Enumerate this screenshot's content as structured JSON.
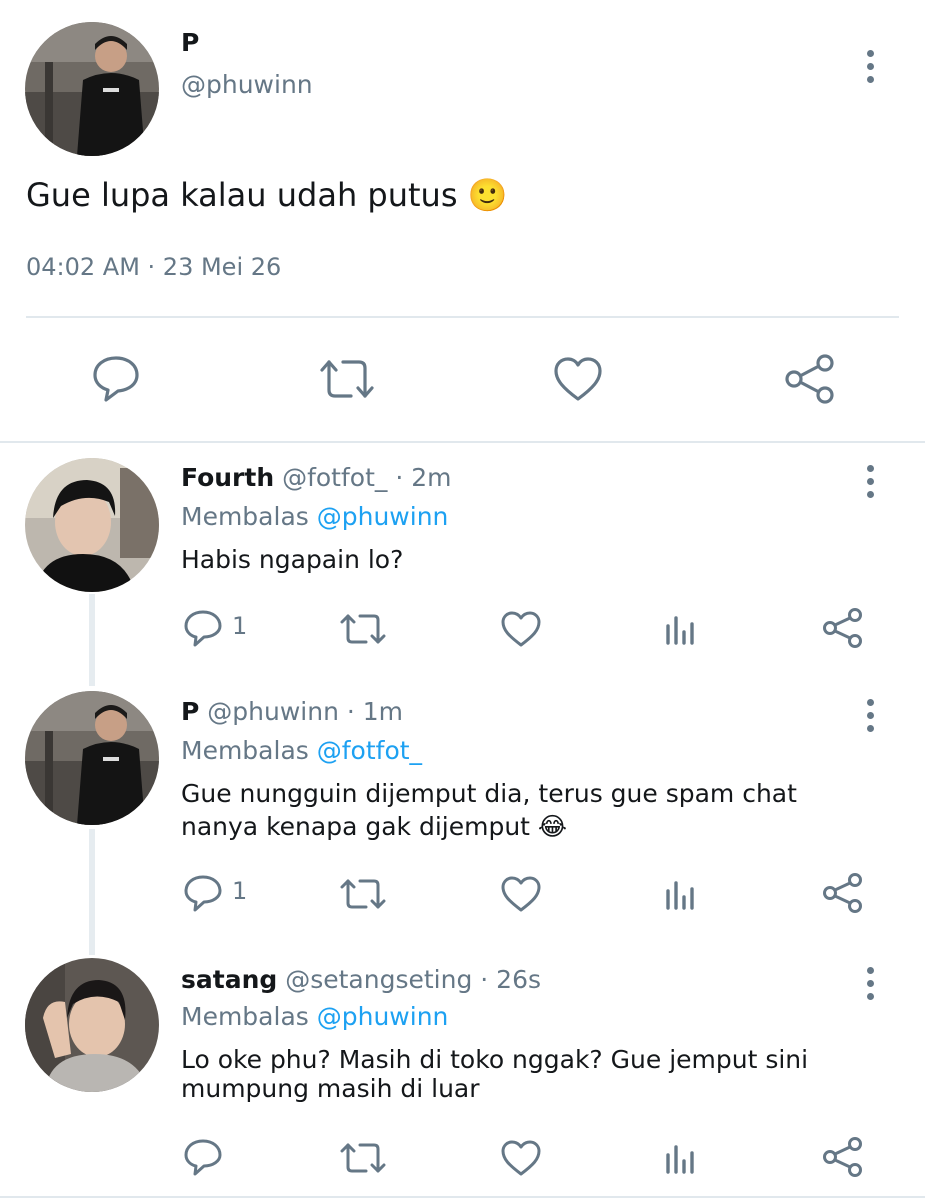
{
  "main_tweet": {
    "display_name": "P",
    "handle": "@phuwinn",
    "text": "Gue lupa kalau udah putus",
    "emoji": "🙂",
    "timestamp": "04:02 AM · 23 Mei 26"
  },
  "replies": [
    {
      "display_name": "Fourth",
      "handle_meta": "@fotfot_ · 2m",
      "replying_prefix": "Membalas",
      "replying_to": "@phuwinn",
      "text": "Habis ngapain lo?",
      "reply_count": "1"
    },
    {
      "display_name": "P",
      "handle_meta": "@phuwinn · 1m",
      "replying_prefix": "Membalas",
      "replying_to": "@fotfot_",
      "text_line1": "Gue nungguin dijemput dia, terus gue spam chat",
      "text_line2": "nanya kenapa gak dijemput",
      "emoji": "😂",
      "reply_count": "1"
    },
    {
      "display_name": "satang",
      "handle_meta": "@setangseting · 26s",
      "replying_prefix": "Membalas",
      "replying_to": "@phuwinn",
      "text_line1": "Lo oke phu? Masih di toko nggak? Gue jemput sini",
      "text_line2": "mumpung masih di luar",
      "reply_count": ""
    }
  ],
  "colors": {
    "text": "#14171a",
    "secondary": "#657786",
    "link": "#1da1f2",
    "divider": "#e1e8ed"
  }
}
